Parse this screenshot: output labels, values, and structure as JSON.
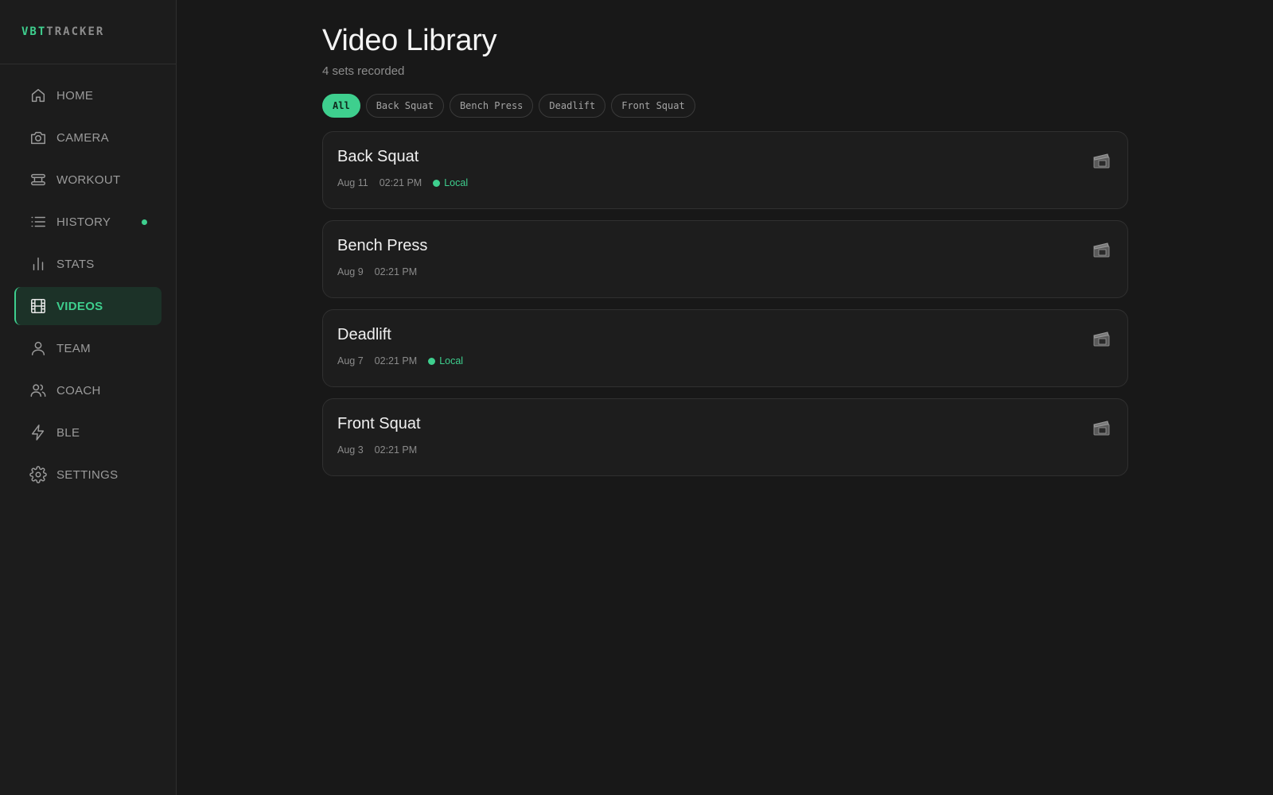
{
  "brand": {
    "part1": "VBT",
    "part2": "TRACKER"
  },
  "nav": {
    "items": [
      {
        "label": "HOME",
        "icon": "home-icon"
      },
      {
        "label": "CAMERA",
        "icon": "camera-icon"
      },
      {
        "label": "WORKOUT",
        "icon": "workout-icon"
      },
      {
        "label": "HISTORY",
        "icon": "list-icon",
        "has_dot": true
      },
      {
        "label": "STATS",
        "icon": "bar-chart-icon"
      },
      {
        "label": "VIDEOS",
        "icon": "film-icon",
        "active": true
      },
      {
        "label": "TEAM",
        "icon": "user-icon"
      },
      {
        "label": "COACH",
        "icon": "users-icon"
      },
      {
        "label": "BLE",
        "icon": "lightning-icon"
      },
      {
        "label": "SETTINGS",
        "icon": "gear-icon"
      }
    ]
  },
  "main": {
    "title": "Video Library",
    "subtitle": "4 sets recorded",
    "filters": [
      "All",
      "Back Squat",
      "Bench Press",
      "Deadlift",
      "Front Squat"
    ],
    "active_filter": "All",
    "videos": [
      {
        "title": "Back Squat",
        "date": "Aug 11",
        "time": "02:21 PM",
        "status": "Local"
      },
      {
        "title": "Bench Press",
        "date": "Aug 9",
        "time": "02:21 PM",
        "status": ""
      },
      {
        "title": "Deadlift",
        "date": "Aug 7",
        "time": "02:21 PM",
        "status": "Local"
      },
      {
        "title": "Front Squat",
        "date": "Aug 3",
        "time": "02:21 PM",
        "status": ""
      }
    ]
  },
  "colors": {
    "accent": "#3ecf8e",
    "background": "#181818",
    "sidebar": "#1c1c1c"
  }
}
